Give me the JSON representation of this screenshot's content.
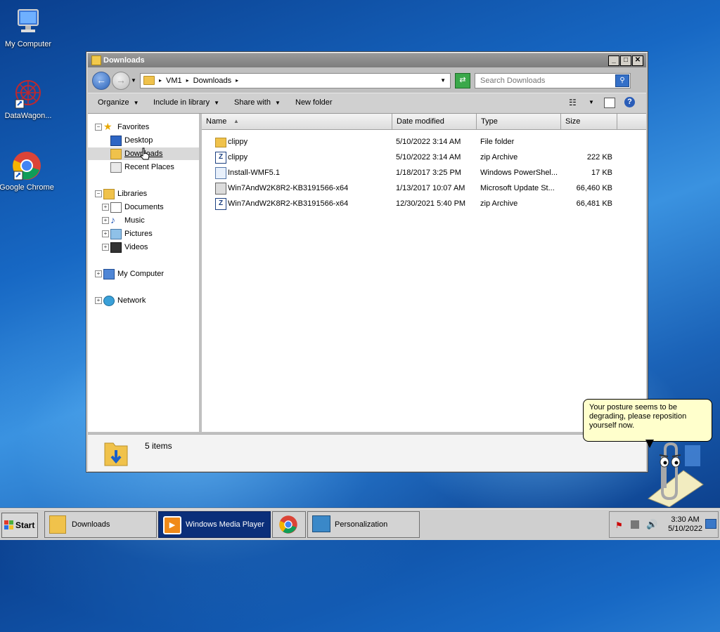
{
  "desktop": {
    "icons": [
      {
        "label": "My Computer"
      },
      {
        "label": "DataWagon..."
      },
      {
        "label": "Google Chrome"
      }
    ]
  },
  "window": {
    "title": "Downloads",
    "controls": {
      "minimize": "_",
      "maximize": "□",
      "close": "✕"
    }
  },
  "address": {
    "crumbs": [
      "VM1",
      "Downloads"
    ],
    "search_placeholder": "Search Downloads"
  },
  "toolbar": {
    "organize": "Organize",
    "include_in_library": "Include in library",
    "share_with": "Share with",
    "new_folder": "New folder"
  },
  "nav": {
    "favorites": "Favorites",
    "desktop": "Desktop",
    "downloads": "Downloads",
    "recent_places": "Recent Places",
    "libraries": "Libraries",
    "documents": "Documents",
    "music": "Music",
    "pictures": "Pictures",
    "videos": "Videos",
    "my_computer": "My Computer",
    "network": "Network"
  },
  "columns": {
    "name": "Name",
    "date": "Date modified",
    "type": "Type",
    "size": "Size"
  },
  "files": [
    {
      "name": "clippy",
      "date": "5/10/2022 3:14 AM",
      "type": "File folder",
      "size": "",
      "icon": "folder-icon"
    },
    {
      "name": "clippy",
      "date": "5/10/2022 3:14 AM",
      "type": "zip Archive",
      "size": "222 KB",
      "icon": "zip-icon"
    },
    {
      "name": "Install-WMF5.1",
      "date": "1/18/2017 3:25 PM",
      "type": "Windows PowerShel...",
      "size": "17 KB",
      "icon": "script-icon"
    },
    {
      "name": "Win7AndW2K8R2-KB3191566-x64",
      "date": "1/13/2017 10:07 AM",
      "type": "Microsoft Update St...",
      "size": "66,460 KB",
      "icon": "update-package-icon"
    },
    {
      "name": "Win7AndW2K8R2-KB3191566-x64",
      "date": "12/30/2021 5:40 PM",
      "type": "zip Archive",
      "size": "66,481 KB",
      "icon": "zip-icon"
    }
  ],
  "details": {
    "count": "5 items"
  },
  "clippy": {
    "message": "Your posture seems to be degrading, please reposition yourself now."
  },
  "taskbar": {
    "start": "Start",
    "tasks": [
      {
        "label": "Downloads"
      },
      {
        "label": "Windows Media Player"
      },
      {
        "label": ""
      },
      {
        "label": "Personalization"
      }
    ],
    "time": "3:30 AM",
    "date": "5/10/2022"
  },
  "colors": {
    "desktop_blue": "#1768c4",
    "titlebar_gray": "#8a8a8a",
    "tooltip_yellow": "#ffffcc",
    "active_task": "#0b2f7a"
  }
}
